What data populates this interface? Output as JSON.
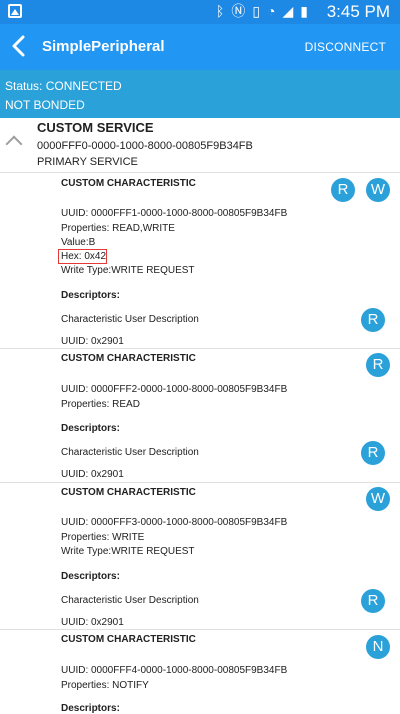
{
  "statusbar": {
    "time": "3:45 PM",
    "icons": [
      "image-icon",
      "bluetooth-icon",
      "nfc-icon",
      "vibrate-icon",
      "wifi-4g-icon",
      "signal-icon",
      "battery-icon"
    ]
  },
  "appbar": {
    "title": "SimplePeripheral",
    "action": "DISCONNECT"
  },
  "status": {
    "connection": "Status: CONNECTED",
    "bond": "NOT BONDED"
  },
  "service": {
    "title": "CUSTOM SERVICE",
    "uuid": "0000FFF0-0000-1000-8000-00805F9B34FB",
    "type": "PRIMARY SERVICE"
  },
  "characteristics": [
    {
      "title": "CUSTOM CHARACTERISTIC",
      "uuid": "UUID: 0000FFF1-0000-1000-8000-00805F9B34FB",
      "properties": "Properties: READ,WRITE",
      "value": "Value:B",
      "hex": "Hex: 0x42",
      "write_type": "Write Type:WRITE REQUEST",
      "descriptors_label": "Descriptors:",
      "descriptor_name": "Characteristic User Description",
      "descriptor_uuid": "UUID: 0x2901",
      "buttons": [
        "R",
        "W"
      ],
      "descriptor_button": "R"
    },
    {
      "title": "CUSTOM CHARACTERISTIC",
      "uuid": "UUID: 0000FFF2-0000-1000-8000-00805F9B34FB",
      "properties": "Properties: READ",
      "descriptors_label": "Descriptors:",
      "descriptor_name": "Characteristic User Description",
      "descriptor_uuid": "UUID: 0x2901",
      "buttons": [
        "R"
      ],
      "descriptor_button": "R"
    },
    {
      "title": "CUSTOM CHARACTERISTIC",
      "uuid": "UUID: 0000FFF3-0000-1000-8000-00805F9B34FB",
      "properties": "Properties: WRITE",
      "write_type": "Write Type:WRITE REQUEST",
      "descriptors_label": "Descriptors:",
      "descriptor_name": "Characteristic User Description",
      "descriptor_uuid": "UUID: 0x2901",
      "buttons": [
        "W"
      ],
      "descriptor_button": "R"
    },
    {
      "title": "CUSTOM CHARACTERISTIC",
      "uuid": "UUID: 0000FFF4-0000-1000-8000-00805F9B34FB",
      "properties": "Properties: NOTIFY",
      "descriptors_label": "Descriptors:",
      "buttons": [
        "N"
      ]
    }
  ],
  "colors": {
    "statusbar": "#1e88e5",
    "appbar": "#2196f3",
    "status_block": "#2aa1d8",
    "button": "#2aa1d8",
    "highlight_box": "#e53935"
  }
}
